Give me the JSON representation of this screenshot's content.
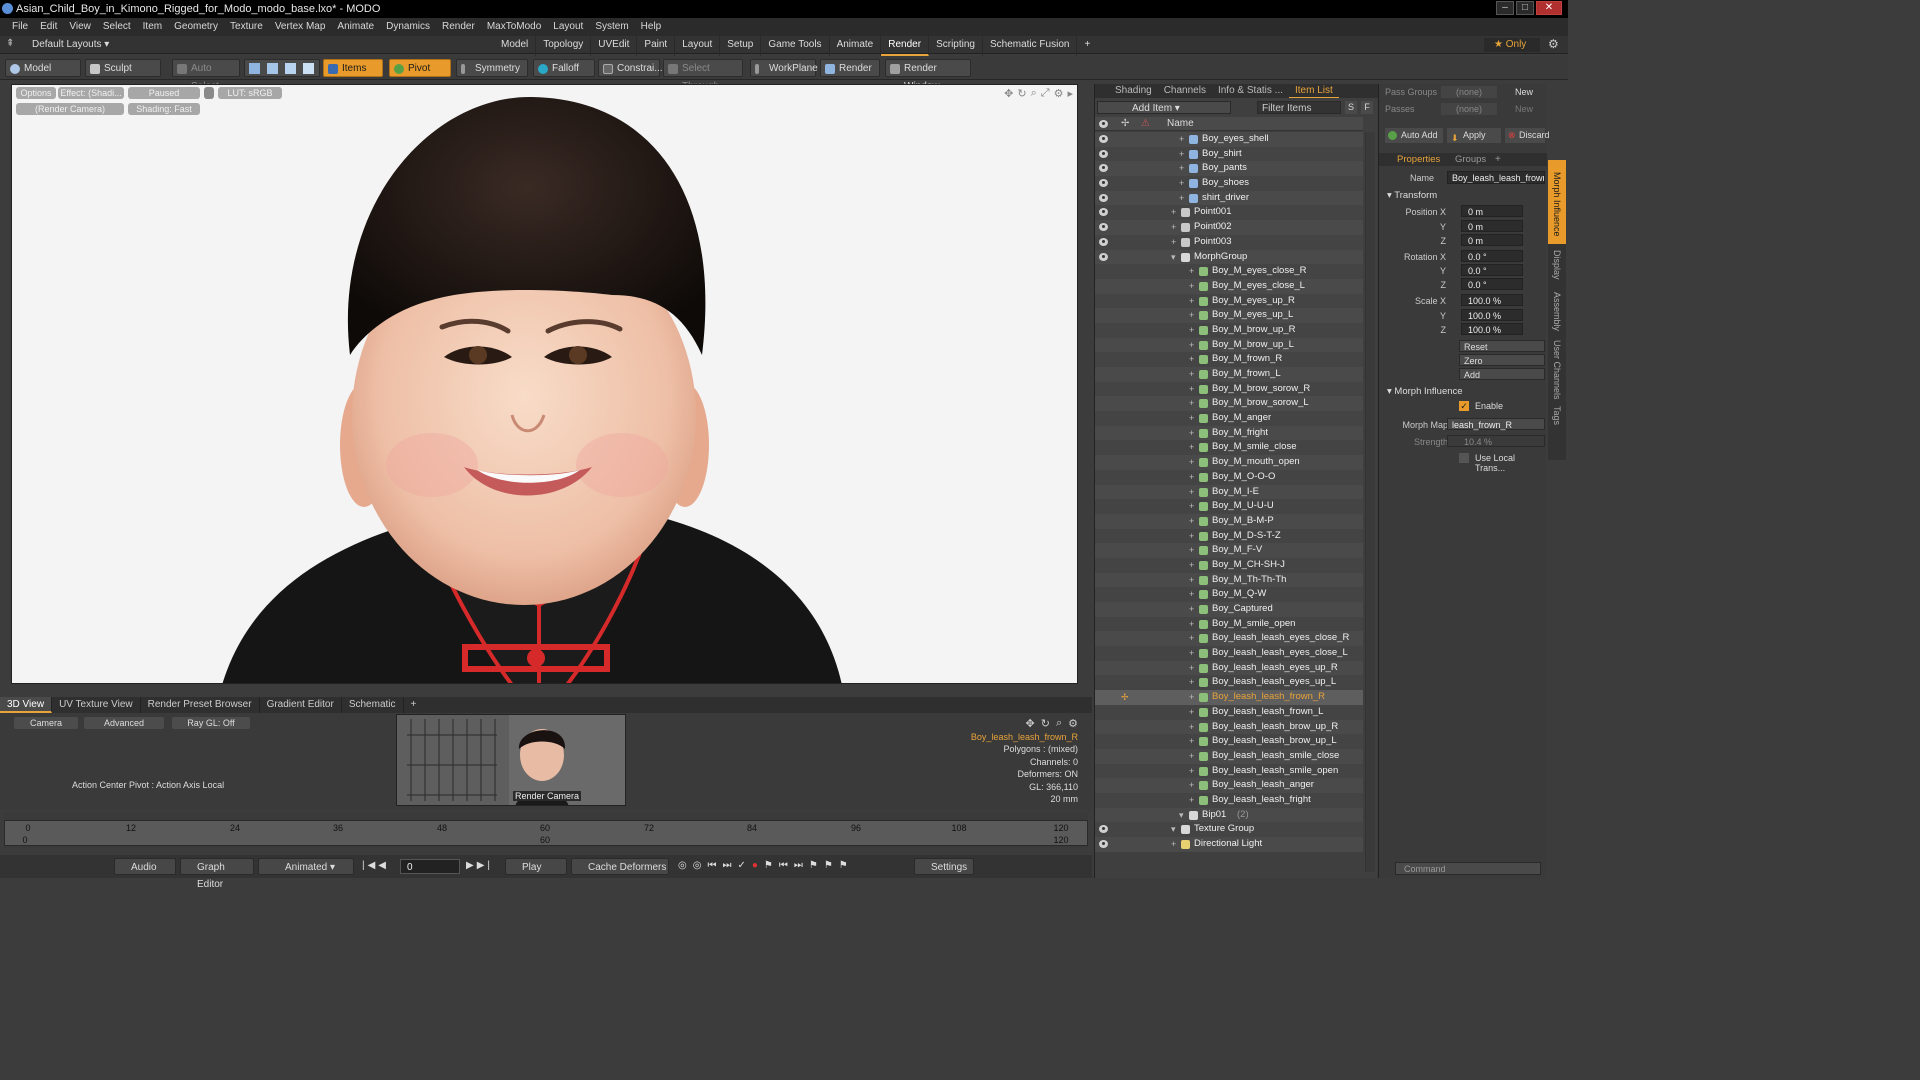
{
  "window": {
    "title": "Asian_Child_Boy_in_Kimono_Rigged_for_Modo_modo_base.lxo* - MODO",
    "min": "–",
    "max": "□",
    "close": "✕"
  },
  "menu": [
    "File",
    "Edit",
    "View",
    "Select",
    "Item",
    "Geometry",
    "Texture",
    "Vertex Map",
    "Animate",
    "Dynamics",
    "Render",
    "MaxToModo",
    "Layout",
    "System",
    "Help"
  ],
  "layout": {
    "preset": "Default Layouts ▾",
    "tabs": [
      "Model",
      "Topology",
      "UVEdit",
      "Paint",
      "Layout",
      "Setup",
      "Game Tools",
      "Animate",
      "Render",
      "Scripting",
      "Schematic Fusion"
    ],
    "active": "Render",
    "plus": "+",
    "only": "★  Only"
  },
  "toolbar": {
    "model": "Model",
    "sculpt": "Sculpt",
    "auto_select": "Auto Select",
    "items": "Items",
    "pivot": "Pivot",
    "symmetry": "Symmetry",
    "falloff": "Falloff",
    "constraints": "Constrai...",
    "select_through": "Select Through",
    "workplane": "WorkPlane",
    "render": "Render",
    "render_window": "Render Window"
  },
  "viewport": {
    "options": "Options",
    "effect": "Effect: (Shadi...",
    "paused": "Paused",
    "lut": "LUT: sRGB",
    "camera": "(Render Camera)",
    "shading": "Shading: Fast"
  },
  "bottom": {
    "tabs": [
      "3D View",
      "UV Texture View",
      "Render Preset Browser",
      "Gradient Editor",
      "Schematic"
    ],
    "active": "3D View",
    "buttons": {
      "camera": "Camera",
      "advanced": "Advanced",
      "raygl": "Ray GL: Off"
    },
    "action_center": "Action Center Pivot : Action Axis Local",
    "thumb_label": "Render Camera",
    "info": {
      "item": "Boy_leash_leash_frown_R",
      "polygons": "Polygons : (mixed)",
      "channels": "Channels: 0",
      "deformers": "Deformers: ON",
      "gl": "GL: 366,110",
      "size": "20 mm"
    }
  },
  "timeline": {
    "top": [
      "0",
      "12",
      "24",
      "36",
      "48",
      "60",
      "72",
      "84",
      "96",
      "108",
      "120"
    ],
    "bottom": [
      "0",
      "60",
      "120"
    ]
  },
  "playbar": {
    "audio": "Audio",
    "graph_editor": "Graph Editor",
    "animated": "Animated",
    "frame": "0",
    "play": "Play",
    "cache": "Cache Deformers",
    "settings": "Settings"
  },
  "itemlist": {
    "tabs": [
      "Shading",
      "Channels",
      "Info & Statis ...",
      "Item List"
    ],
    "active": "Item List",
    "add_item": "Add Item",
    "filter": "Filter Items",
    "s": "S",
    "f": "F",
    "col_name": "Name",
    "rows": [
      {
        "label": "Boy_eyes_shell",
        "indent": 1,
        "eye": true,
        "kind": "mesh"
      },
      {
        "label": "Boy_shirt",
        "indent": 1,
        "eye": true,
        "kind": "mesh"
      },
      {
        "label": "Boy_pants",
        "indent": 1,
        "eye": true,
        "kind": "mesh"
      },
      {
        "label": "Boy_shoes",
        "indent": 1,
        "eye": true,
        "kind": "mesh"
      },
      {
        "label": "shirt_driver",
        "indent": 1,
        "eye": true,
        "kind": "mesh"
      },
      {
        "label": "Point001",
        "indent": 0,
        "eye": true,
        "kind": "loc"
      },
      {
        "label": "Point002",
        "indent": 0,
        "eye": true,
        "kind": "loc"
      },
      {
        "label": "Point003",
        "indent": 0,
        "eye": true,
        "kind": "loc"
      },
      {
        "label": "MorphGroup",
        "indent": 0,
        "eye": true,
        "kind": "group"
      },
      {
        "label": "Boy_M_eyes_close_R",
        "indent": 2,
        "kind": "morph"
      },
      {
        "label": "Boy_M_eyes_close_L",
        "indent": 2,
        "kind": "morph"
      },
      {
        "label": "Boy_M_eyes_up_R",
        "indent": 2,
        "kind": "morph"
      },
      {
        "label": "Boy_M_eyes_up_L",
        "indent": 2,
        "kind": "morph"
      },
      {
        "label": "Boy_M_brow_up_R",
        "indent": 2,
        "kind": "morph"
      },
      {
        "label": "Boy_M_brow_up_L",
        "indent": 2,
        "kind": "morph"
      },
      {
        "label": "Boy_M_frown_R",
        "indent": 2,
        "kind": "morph"
      },
      {
        "label": "Boy_M_frown_L",
        "indent": 2,
        "kind": "morph"
      },
      {
        "label": "Boy_M_brow_sorow_R",
        "indent": 2,
        "kind": "morph"
      },
      {
        "label": "Boy_M_brow_sorow_L",
        "indent": 2,
        "kind": "morph"
      },
      {
        "label": "Boy_M_anger",
        "indent": 2,
        "kind": "morph"
      },
      {
        "label": "Boy_M_fright",
        "indent": 2,
        "kind": "morph"
      },
      {
        "label": "Boy_M_smile_close",
        "indent": 2,
        "kind": "morph"
      },
      {
        "label": "Boy_M_mouth_open",
        "indent": 2,
        "kind": "morph"
      },
      {
        "label": "Boy_M_O-O-O",
        "indent": 2,
        "kind": "morph"
      },
      {
        "label": "Boy_M_I-E",
        "indent": 2,
        "kind": "morph"
      },
      {
        "label": "Boy_M_U-U-U",
        "indent": 2,
        "kind": "morph"
      },
      {
        "label": "Boy_M_B-M-P",
        "indent": 2,
        "kind": "morph"
      },
      {
        "label": "Boy_M_D-S-T-Z",
        "indent": 2,
        "kind": "morph"
      },
      {
        "label": "Boy_M_F-V",
        "indent": 2,
        "kind": "morph"
      },
      {
        "label": "Boy_M_CH-SH-J",
        "indent": 2,
        "kind": "morph"
      },
      {
        "label": "Boy_M_Th-Th-Th",
        "indent": 2,
        "kind": "morph"
      },
      {
        "label": "Boy_M_Q-W",
        "indent": 2,
        "kind": "morph"
      },
      {
        "label": "Boy_Captured",
        "indent": 2,
        "kind": "morph"
      },
      {
        "label": "Boy_M_smile_open",
        "indent": 2,
        "kind": "morph"
      },
      {
        "label": "Boy_leash_leash_eyes_close_R",
        "indent": 2,
        "kind": "morph"
      },
      {
        "label": "Boy_leash_leash_eyes_close_L",
        "indent": 2,
        "kind": "morph"
      },
      {
        "label": "Boy_leash_leash_eyes_up_R",
        "indent": 2,
        "kind": "morph"
      },
      {
        "label": "Boy_leash_leash_eyes_up_L",
        "indent": 2,
        "kind": "morph"
      },
      {
        "label": "Boy_leash_leash_frown_R",
        "indent": 2,
        "kind": "morph",
        "selected": true
      },
      {
        "label": "Boy_leash_leash_frown_L",
        "indent": 2,
        "kind": "morph"
      },
      {
        "label": "Boy_leash_leash_brow_up_R",
        "indent": 2,
        "kind": "morph"
      },
      {
        "label": "Boy_leash_leash_brow_up_L",
        "indent": 2,
        "kind": "morph"
      },
      {
        "label": "Boy_leash_leash_smile_close",
        "indent": 2,
        "kind": "morph"
      },
      {
        "label": "Boy_leash_leash_smile_open",
        "indent": 2,
        "kind": "morph"
      },
      {
        "label": "Boy_leash_leash_anger",
        "indent": 2,
        "kind": "morph"
      },
      {
        "label": "Boy_leash_leash_fright",
        "indent": 2,
        "kind": "morph"
      },
      {
        "label": "Bip01",
        "count": "(2)",
        "indent": 1,
        "kind": "group"
      },
      {
        "label": "Texture Group",
        "indent": 0,
        "eye": true,
        "kind": "group"
      },
      {
        "label": "Directional Light",
        "indent": 0,
        "eye": true,
        "kind": "light"
      }
    ]
  },
  "props": {
    "pass_groups": "Pass Groups",
    "none": "(none)",
    "new": "New",
    "passes": "Passes",
    "auto_add": "Auto Add",
    "apply": "Apply",
    "discard": "Discard",
    "tabs": [
      "Properties",
      "Groups"
    ],
    "active": "Properties",
    "name_label": "Name",
    "name_value": "Boy_leash_leash_frown",
    "transform": "Transform",
    "pos_label": "Position X",
    "rot_label": "Rotation X",
    "scale_label": "Scale X",
    "y": "Y",
    "z": "Z",
    "pos": [
      "0 m",
      "0 m",
      "0 m"
    ],
    "rot": [
      "0.0 °",
      "0.0 °",
      "0.0 °"
    ],
    "scale": [
      "100.0 %",
      "100.0 %",
      "100.0 %"
    ],
    "reset": "Reset",
    "zero": "Zero",
    "add": "Add",
    "morph_influence": "Morph Influence",
    "enable": "Enable",
    "morph_map_label": "Morph Map",
    "morph_map": "leash_frown_R",
    "strength_label": "Strength",
    "strength": "10.4 %",
    "use_local": "Use Local Trans...",
    "vtabs": [
      "Morph Influence",
      "Display",
      "Assembly",
      "User Channels",
      "Tags"
    ],
    "command": "Command"
  }
}
